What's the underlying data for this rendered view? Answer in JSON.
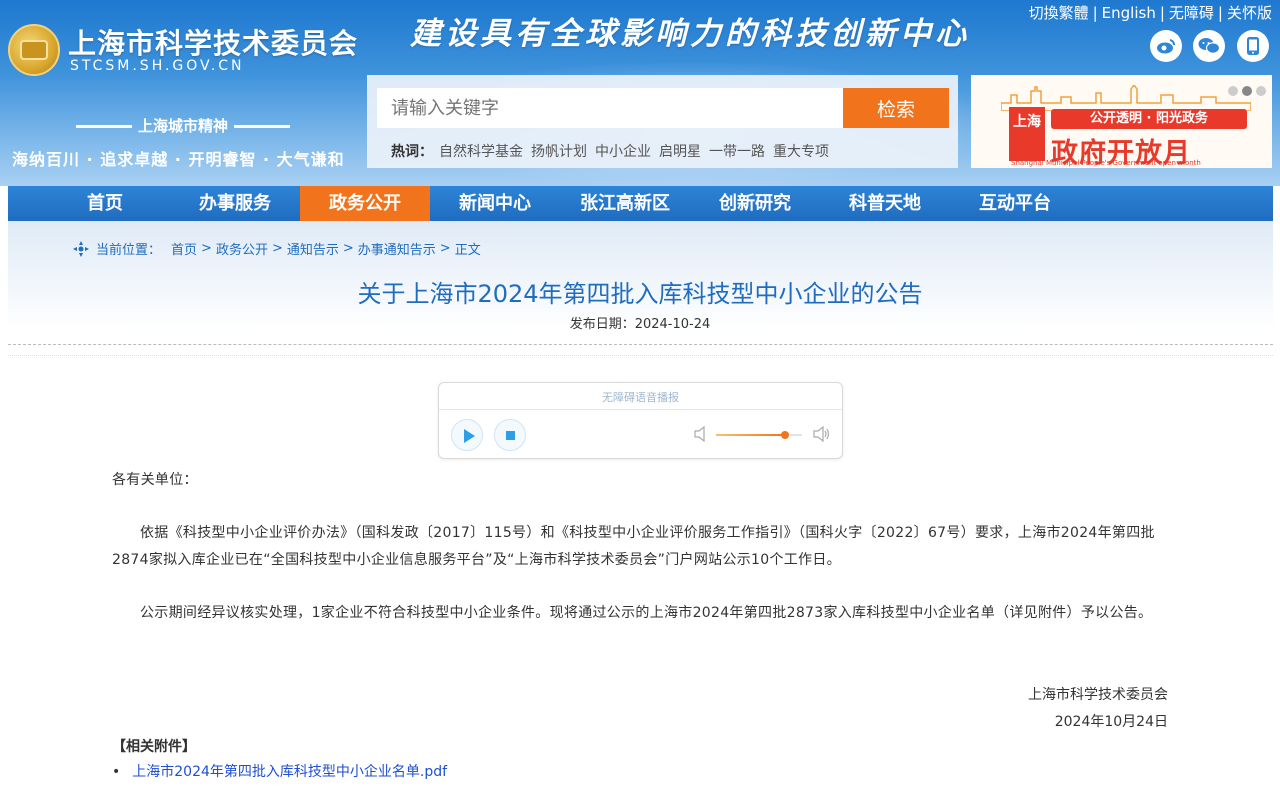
{
  "header": {
    "site_title_cn": "上海市科学技术委员会",
    "site_title_en": "STCSM.SH.GOV.CN",
    "slogan": "建设具有全球影响力的科技创新中心",
    "top_links": [
      "切換繁體",
      "English",
      "无障碍",
      "关怀版"
    ],
    "city_spirit_title": "上海城市精神",
    "city_spirit_text": "海纳百川 · 追求卓越 · 开明睿智 · 大气谦和",
    "social_icons": [
      "weibo-icon",
      "wechat-icon",
      "mobile-icon"
    ]
  },
  "search": {
    "placeholder": "请输入关键字",
    "button_label": "检索",
    "hot_label": "热词：",
    "hot_words": [
      "自然科学基金",
      "扬帆计划",
      "中小企业",
      "启明星",
      "一带一路",
      "重大专项"
    ]
  },
  "banner": {
    "tag": "公开透明 · 阳光政务",
    "city": "上海",
    "main_text": "政府开放月",
    "english_text": "Shanghai Municipal People's Government open month"
  },
  "nav": {
    "items": [
      "首页",
      "办事服务",
      "政务公开",
      "新闻中心",
      "张江高新区",
      "创新研究",
      "科普天地",
      "互动平台"
    ],
    "active_index": 2
  },
  "breadcrumb": {
    "label": "当前位置：",
    "items": [
      "首页",
      "政务公开",
      "通知告示",
      "办事通知告示",
      "正文"
    ]
  },
  "article": {
    "title": "关于上海市2024年第四批入库科技型中小企业的公告",
    "date_label": "发布日期：",
    "date": "2024-10-24",
    "greeting": "各有关单位：",
    "paragraph1": "依据《科技型中小企业评价办法》（国科发政〔2017〕115号）和《科技型中小企业评价服务工作指引》（国科火字〔2022〕67号）要求，上海市2024年第四批2874家拟入库企业已在“全国科技型中小企业信息服务平台”及“上海市科学技术委员会”门户网站公示10个工作日。",
    "paragraph2": "公示期间经异议核实处理，1家企业不符合科技型中小企业条件。现将通过公示的上海市2024年第四批2873家入库科技型中小企业名单（详见附件）予以公告。",
    "signature_org": "上海市科学技术委员会",
    "signature_date": "2024年10月24日",
    "attachments_label": "【相关附件】",
    "attachments": [
      "上海市2024年第四批入库科技型中小企业名单.pdf"
    ]
  },
  "player": {
    "title": "无障碍语音播报",
    "volume": 0.8
  },
  "colors": {
    "primary_blue": "#1f6cc0",
    "accent_orange": "#f1731b",
    "banner_red": "#e8392b"
  }
}
